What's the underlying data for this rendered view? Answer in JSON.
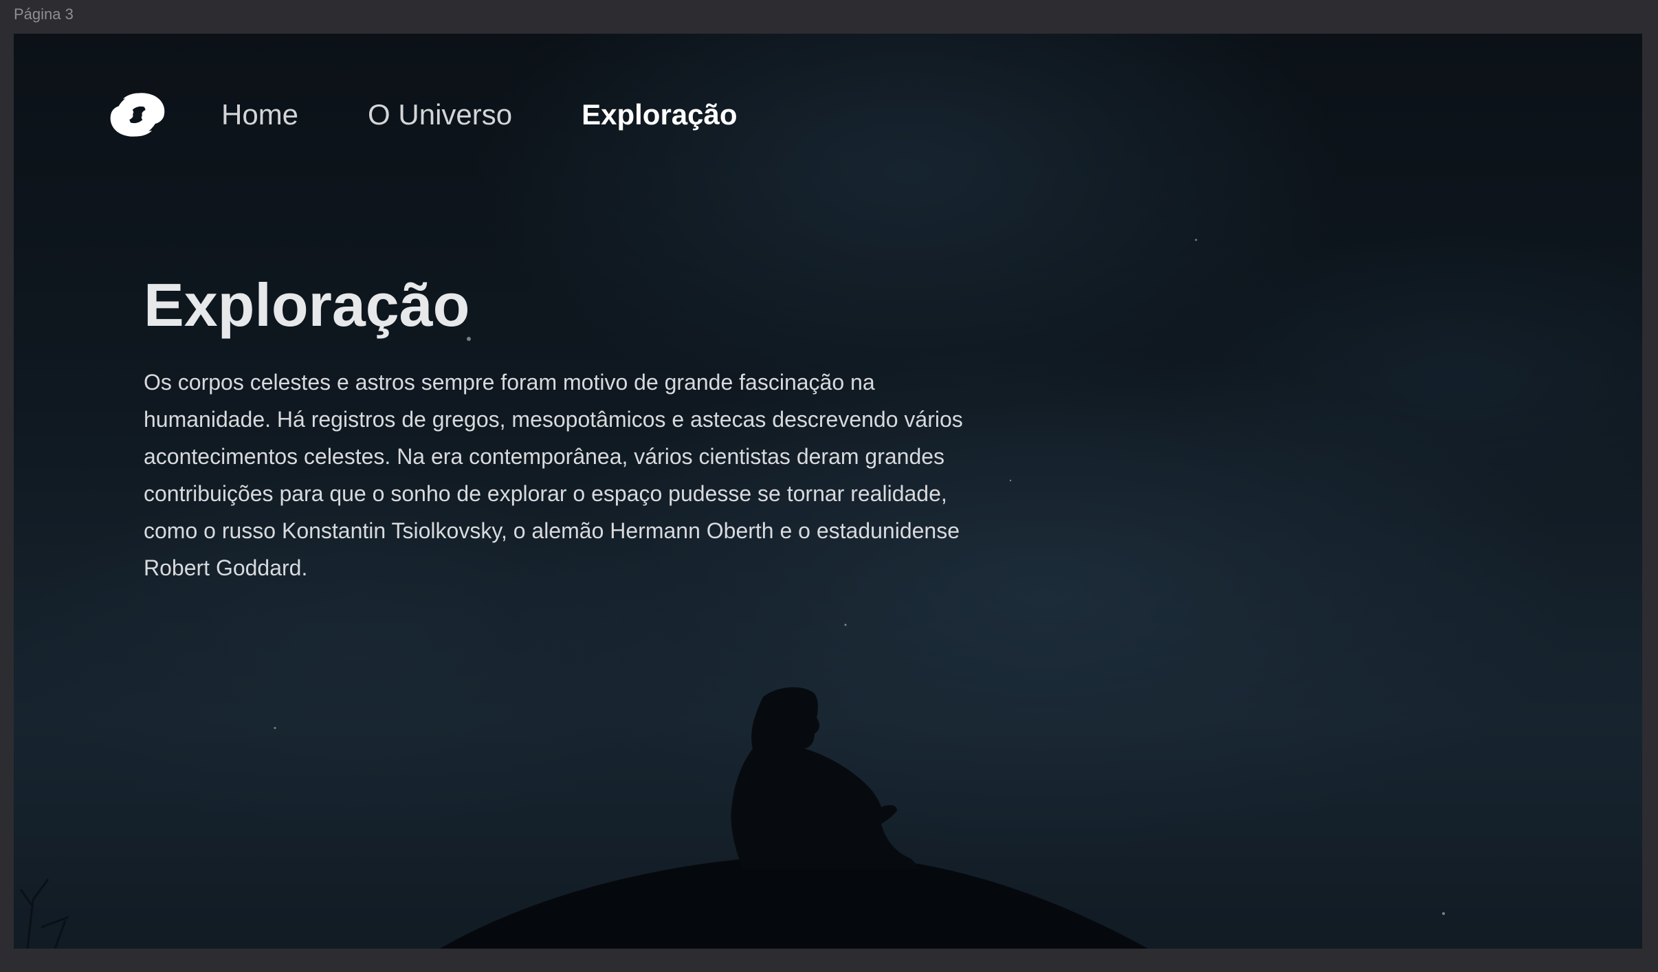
{
  "window": {
    "page_label": "Página 3"
  },
  "nav": {
    "logo_icon": "spiral-galaxy-icon",
    "items": [
      {
        "label": "Home",
        "active": false
      },
      {
        "label": "O Universo",
        "active": false
      },
      {
        "label": "Exploração",
        "active": true
      }
    ]
  },
  "hero": {
    "title": "Exploração",
    "text": "Os corpos celestes e astros sempre foram motivo de grande fascinação na humanidade. Há registros de gregos, mesopotâmicos e astecas descrevendo vários acontecimentos celestes. Na era contemporânea, vários cientistas deram grandes contribuições para que o sonho de explorar o espaço pudesse se tornar realidade, como o russo Konstantin Tsiolkovsky, o alemão Hermann Oberth e o estadunidense Robert Goddard."
  },
  "colors": {
    "canvas_background": "#2c2c31",
    "frame_background": "#0f1820",
    "nav_text": "#d3d5d8",
    "nav_active_text": "#ffffff",
    "title_text": "#e7e8ea",
    "body_text": "#d8dadd"
  }
}
